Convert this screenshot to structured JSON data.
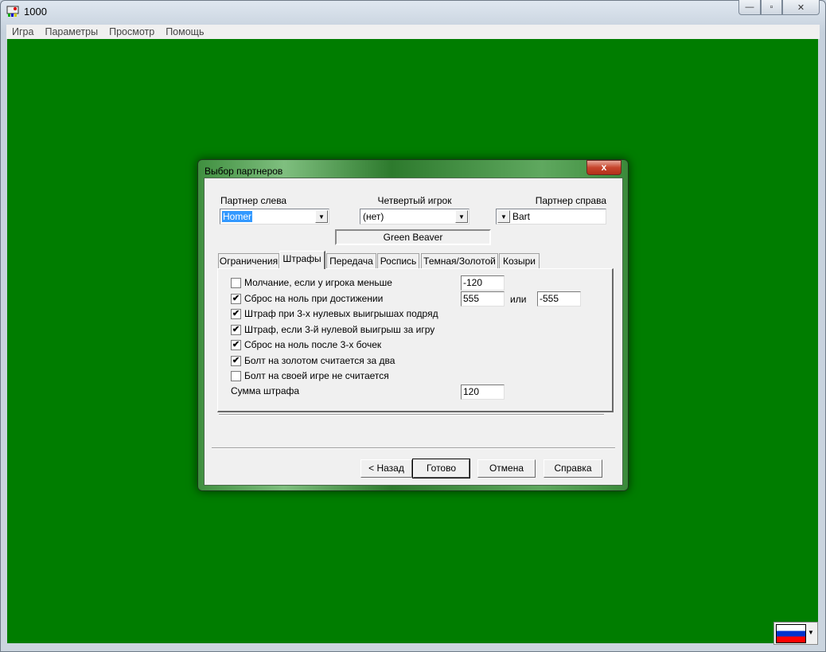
{
  "window": {
    "title": "1000",
    "min": "—",
    "max": "▫",
    "close": "✕"
  },
  "menu": [
    "Игра",
    "Параметры",
    "Просмотр",
    "Помощь"
  ],
  "dialog": {
    "title": "Выбор партнеров",
    "close": "x",
    "left_label": "Партнер слева",
    "left_value": "Homer",
    "fourth_label": "Четвертый игрок",
    "fourth_value": "(нет)",
    "right_label": "Партнер справа",
    "right_value": "Bart",
    "team": "Green Beaver",
    "tabs": [
      "Ограничения",
      "Штрафы",
      "Передача",
      "Роспись",
      "Темная/Золотой",
      "Козыри"
    ],
    "active_tab": "Штрафы",
    "options": [
      {
        "label": "Молчание, если у игрока меньше",
        "checked": false
      },
      {
        "label": "Сброс на ноль при достижении",
        "checked": true
      },
      {
        "label": "Штраф при 3-х нулевых выигрышах подряд",
        "checked": true
      },
      {
        "label": "Штраф, если 3-й нулевой выигрыш за игру",
        "checked": true
      },
      {
        "label": "Сброс на ноль после 3-х бочек",
        "checked": true
      },
      {
        "label": "Болт на золотом считается за два",
        "checked": true
      },
      {
        "label": "Болт на своей игре не считается",
        "checked": false
      }
    ],
    "silence_value": "-120",
    "reset_value": "555",
    "or_label": "или",
    "reset_value2": "-555",
    "penalty_label": "Сумма штрафа",
    "penalty_value": "120",
    "buttons": {
      "back": "< Назад",
      "done": "Готово",
      "cancel": "Отмена",
      "help": "Справка"
    }
  },
  "language": {
    "selected": "Русский",
    "flag_colors": [
      "#ffffff",
      "#0033cc",
      "#ff0000"
    ]
  }
}
